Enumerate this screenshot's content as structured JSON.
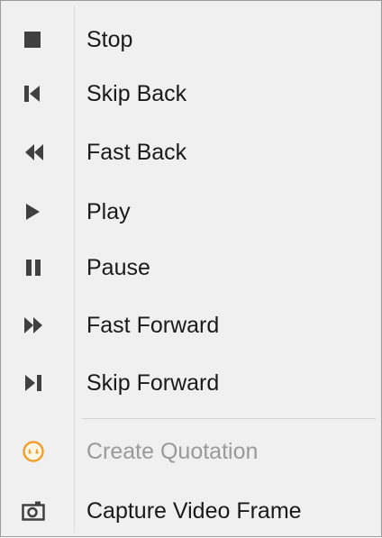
{
  "menu": {
    "items": [
      {
        "label": "Stop",
        "icon": "stop-icon",
        "enabled": true
      },
      {
        "label": "Skip Back",
        "icon": "skip-back-icon",
        "enabled": true
      },
      {
        "label": "Fast Back",
        "icon": "fast-back-icon",
        "enabled": true
      },
      {
        "label": "Play",
        "icon": "play-icon",
        "enabled": true
      },
      {
        "label": "Pause",
        "icon": "pause-icon",
        "enabled": true
      },
      {
        "label": "Fast Forward",
        "icon": "fast-forward-icon",
        "enabled": true
      },
      {
        "label": "Skip Forward",
        "icon": "skip-forward-icon",
        "enabled": true
      },
      {
        "label": "Create Quotation",
        "icon": "quotation-icon",
        "enabled": false
      },
      {
        "label": "Capture Video Frame",
        "icon": "camera-icon",
        "enabled": true
      }
    ]
  },
  "colors": {
    "background": "#f0f0f0",
    "border": "#9b9b9b",
    "icon": "#404040",
    "text": "#1a1a1a",
    "disabled_text": "#9a9a9a",
    "quotation_icon": "#f0a030"
  }
}
